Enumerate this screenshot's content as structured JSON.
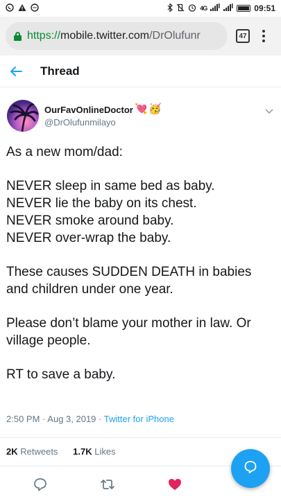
{
  "status_bar": {
    "left_icons": [
      "whatsapp-icon",
      "warning-icon",
      "message-icon"
    ],
    "network_label": "4G",
    "time": "09:51"
  },
  "browser": {
    "url_scheme": "https://",
    "url_host": "mobile.twitter.com",
    "url_path": "/DrOlufunr",
    "tab_count": "47"
  },
  "header": {
    "title": "Thread"
  },
  "tweet": {
    "display_name": "OurFavOnlineDoctor",
    "emojis": [
      "💘",
      "🥳"
    ],
    "handle": "@DrOlufunmilayo",
    "text": "As a new mom/dad:\n\nNEVER sleep in same bed as baby.\nNEVER lie the baby on its chest.\nNEVER smoke around baby.\nNEVER over-wrap the baby.\n\nThese causes SUDDEN DEATH in babies and children under one year.\n\nPlease don’t blame your mother in law. Or village people.\n\nRT to save a baby.",
    "time": "2:50 PM",
    "date": "Aug 3, 2019",
    "separator": "·",
    "source": "Twitter for iPhone",
    "retweets_count": "2K",
    "retweets_label": "Retweets",
    "likes_count": "1.7K",
    "likes_label": "Likes"
  },
  "colors": {
    "accent": "#1da1f2",
    "like": "#e0245e",
    "secure": "#0a8a36",
    "secondary_text": "#657786"
  }
}
